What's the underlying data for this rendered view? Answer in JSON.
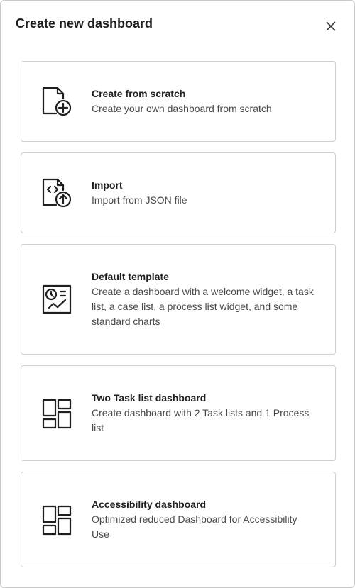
{
  "dialog": {
    "title": "Create new dashboard",
    "close_label": "close"
  },
  "options": [
    {
      "title": "Create from scratch",
      "description": "Create your own dashboard from scratch",
      "icon": "file-plus-icon"
    },
    {
      "title": "Import",
      "description": "Import from JSON file",
      "icon": "file-code-upload-icon"
    },
    {
      "title": "Default template",
      "description": "Create a dashboard with a welcome widget, a task list, a case list, a process list widget, and some standard charts",
      "icon": "report-chart-icon"
    },
    {
      "title": "Two Task list dashboard",
      "description": "Create dashboard with 2 Task lists and 1 Process list",
      "icon": "dashboard-layout-icon"
    },
    {
      "title": "Accessibility dashboard",
      "description": "Optimized reduced Dashboard for Accessibility Use",
      "icon": "dashboard-layout-icon"
    }
  ]
}
